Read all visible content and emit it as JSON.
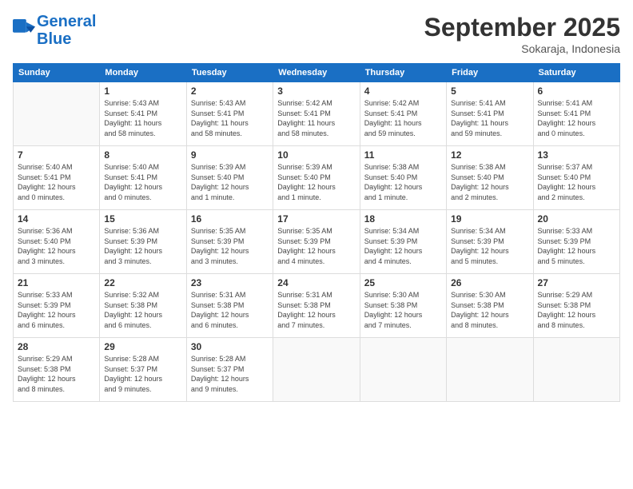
{
  "logo": {
    "line1": "General",
    "line2": "Blue"
  },
  "title": "September 2025",
  "subtitle": "Sokaraja, Indonesia",
  "days_header": [
    "Sunday",
    "Monday",
    "Tuesday",
    "Wednesday",
    "Thursday",
    "Friday",
    "Saturday"
  ],
  "weeks": [
    [
      {
        "num": "",
        "info": ""
      },
      {
        "num": "1",
        "info": "Sunrise: 5:43 AM\nSunset: 5:41 PM\nDaylight: 11 hours\nand 58 minutes."
      },
      {
        "num": "2",
        "info": "Sunrise: 5:43 AM\nSunset: 5:41 PM\nDaylight: 11 hours\nand 58 minutes."
      },
      {
        "num": "3",
        "info": "Sunrise: 5:42 AM\nSunset: 5:41 PM\nDaylight: 11 hours\nand 58 minutes."
      },
      {
        "num": "4",
        "info": "Sunrise: 5:42 AM\nSunset: 5:41 PM\nDaylight: 11 hours\nand 59 minutes."
      },
      {
        "num": "5",
        "info": "Sunrise: 5:41 AM\nSunset: 5:41 PM\nDaylight: 11 hours\nand 59 minutes."
      },
      {
        "num": "6",
        "info": "Sunrise: 5:41 AM\nSunset: 5:41 PM\nDaylight: 12 hours\nand 0 minutes."
      }
    ],
    [
      {
        "num": "7",
        "info": "Sunrise: 5:40 AM\nSunset: 5:41 PM\nDaylight: 12 hours\nand 0 minutes."
      },
      {
        "num": "8",
        "info": "Sunrise: 5:40 AM\nSunset: 5:41 PM\nDaylight: 12 hours\nand 0 minutes."
      },
      {
        "num": "9",
        "info": "Sunrise: 5:39 AM\nSunset: 5:40 PM\nDaylight: 12 hours\nand 1 minute."
      },
      {
        "num": "10",
        "info": "Sunrise: 5:39 AM\nSunset: 5:40 PM\nDaylight: 12 hours\nand 1 minute."
      },
      {
        "num": "11",
        "info": "Sunrise: 5:38 AM\nSunset: 5:40 PM\nDaylight: 12 hours\nand 1 minute."
      },
      {
        "num": "12",
        "info": "Sunrise: 5:38 AM\nSunset: 5:40 PM\nDaylight: 12 hours\nand 2 minutes."
      },
      {
        "num": "13",
        "info": "Sunrise: 5:37 AM\nSunset: 5:40 PM\nDaylight: 12 hours\nand 2 minutes."
      }
    ],
    [
      {
        "num": "14",
        "info": "Sunrise: 5:36 AM\nSunset: 5:40 PM\nDaylight: 12 hours\nand 3 minutes."
      },
      {
        "num": "15",
        "info": "Sunrise: 5:36 AM\nSunset: 5:39 PM\nDaylight: 12 hours\nand 3 minutes."
      },
      {
        "num": "16",
        "info": "Sunrise: 5:35 AM\nSunset: 5:39 PM\nDaylight: 12 hours\nand 3 minutes."
      },
      {
        "num": "17",
        "info": "Sunrise: 5:35 AM\nSunset: 5:39 PM\nDaylight: 12 hours\nand 4 minutes."
      },
      {
        "num": "18",
        "info": "Sunrise: 5:34 AM\nSunset: 5:39 PM\nDaylight: 12 hours\nand 4 minutes."
      },
      {
        "num": "19",
        "info": "Sunrise: 5:34 AM\nSunset: 5:39 PM\nDaylight: 12 hours\nand 5 minutes."
      },
      {
        "num": "20",
        "info": "Sunrise: 5:33 AM\nSunset: 5:39 PM\nDaylight: 12 hours\nand 5 minutes."
      }
    ],
    [
      {
        "num": "21",
        "info": "Sunrise: 5:33 AM\nSunset: 5:39 PM\nDaylight: 12 hours\nand 6 minutes."
      },
      {
        "num": "22",
        "info": "Sunrise: 5:32 AM\nSunset: 5:38 PM\nDaylight: 12 hours\nand 6 minutes."
      },
      {
        "num": "23",
        "info": "Sunrise: 5:31 AM\nSunset: 5:38 PM\nDaylight: 12 hours\nand 6 minutes."
      },
      {
        "num": "24",
        "info": "Sunrise: 5:31 AM\nSunset: 5:38 PM\nDaylight: 12 hours\nand 7 minutes."
      },
      {
        "num": "25",
        "info": "Sunrise: 5:30 AM\nSunset: 5:38 PM\nDaylight: 12 hours\nand 7 minutes."
      },
      {
        "num": "26",
        "info": "Sunrise: 5:30 AM\nSunset: 5:38 PM\nDaylight: 12 hours\nand 8 minutes."
      },
      {
        "num": "27",
        "info": "Sunrise: 5:29 AM\nSunset: 5:38 PM\nDaylight: 12 hours\nand 8 minutes."
      }
    ],
    [
      {
        "num": "28",
        "info": "Sunrise: 5:29 AM\nSunset: 5:38 PM\nDaylight: 12 hours\nand 8 minutes."
      },
      {
        "num": "29",
        "info": "Sunrise: 5:28 AM\nSunset: 5:37 PM\nDaylight: 12 hours\nand 9 minutes."
      },
      {
        "num": "30",
        "info": "Sunrise: 5:28 AM\nSunset: 5:37 PM\nDaylight: 12 hours\nand 9 minutes."
      },
      {
        "num": "",
        "info": ""
      },
      {
        "num": "",
        "info": ""
      },
      {
        "num": "",
        "info": ""
      },
      {
        "num": "",
        "info": ""
      }
    ]
  ]
}
